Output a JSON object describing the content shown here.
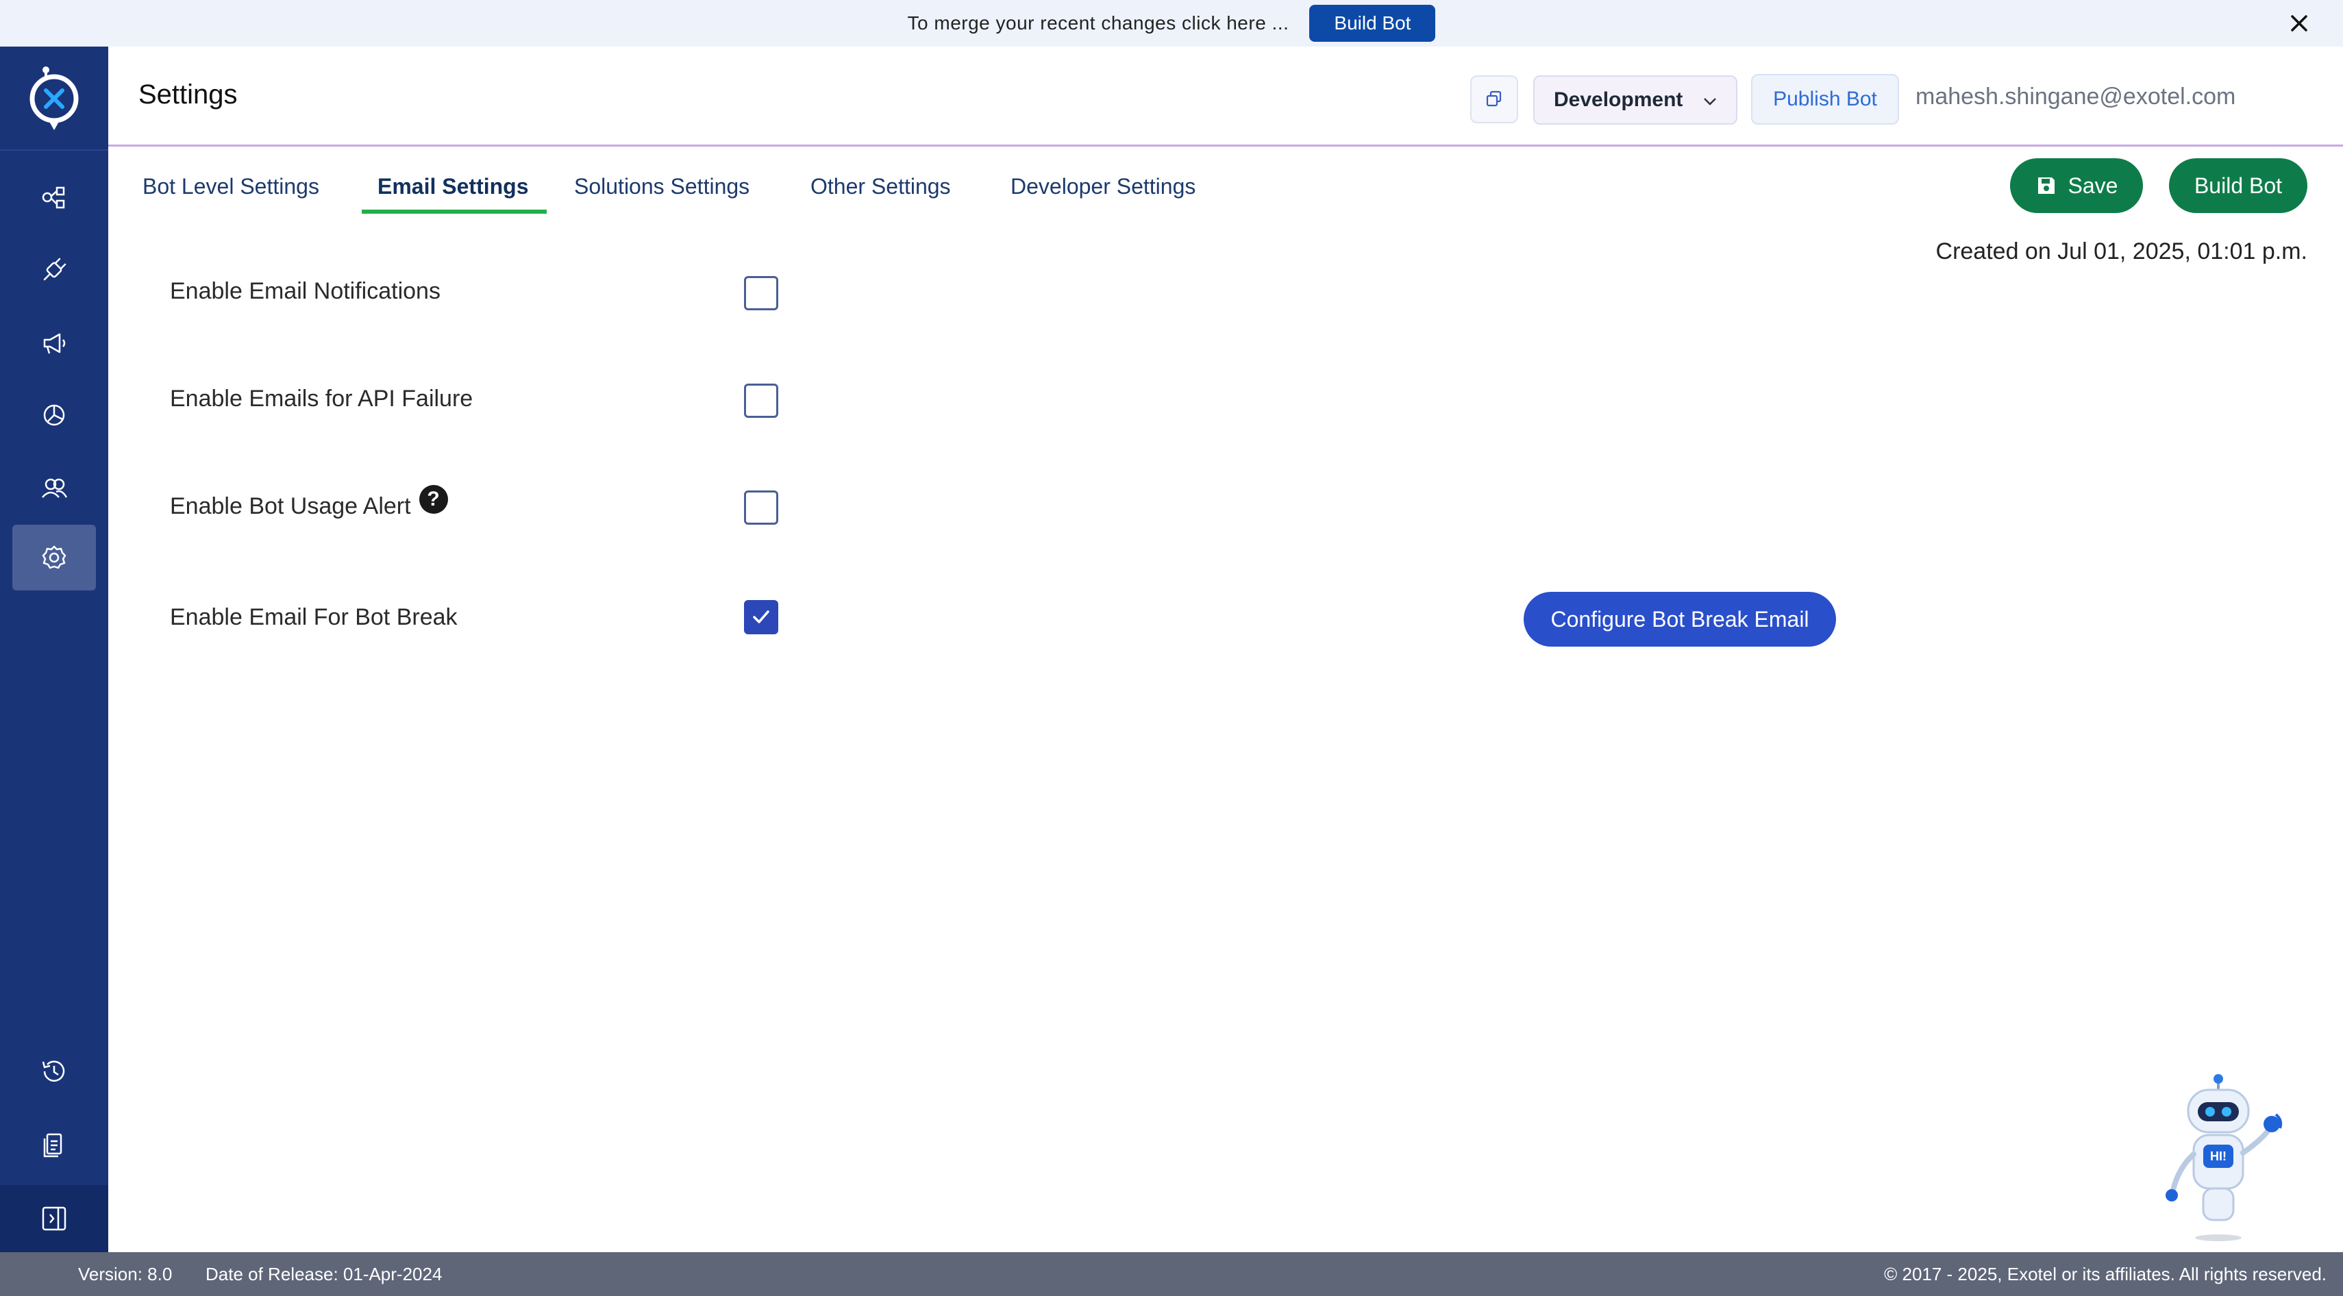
{
  "banner": {
    "message": "To merge your recent changes click here ...",
    "build_label": "Build Bot"
  },
  "sidebar": {
    "items": [
      {
        "icon": "flow-icon"
      },
      {
        "icon": "integrations-icon"
      },
      {
        "icon": "campaign-icon"
      },
      {
        "icon": "analytics-icon"
      },
      {
        "icon": "users-icon"
      },
      {
        "icon": "settings-icon",
        "active": true
      },
      {
        "icon": "history-icon"
      },
      {
        "icon": "documents-icon"
      },
      {
        "icon": "expand-sidebar-icon"
      }
    ]
  },
  "header": {
    "title": "Settings",
    "environment": "Development",
    "publish_label": "Publish Bot",
    "user_email": "mahesh.shingane@exotel.com"
  },
  "tabs": [
    {
      "label": "Bot Level Settings"
    },
    {
      "label": "Email Settings",
      "active": true
    },
    {
      "label": "Solutions Settings"
    },
    {
      "label": "Other Settings"
    },
    {
      "label": "Developer Settings"
    }
  ],
  "actions": {
    "save_label": "Save",
    "build_label": "Build Bot"
  },
  "created_on": "Created on Jul 01, 2025, 01:01 p.m.",
  "settings": [
    {
      "label": "Enable Email Notifications",
      "checked": false
    },
    {
      "label": "Enable Emails for API Failure",
      "checked": false
    },
    {
      "label": "Enable Bot Usage Alert",
      "checked": false,
      "help": "?"
    },
    {
      "label": "Enable Email For Bot Break",
      "checked": true
    }
  ],
  "configure_label": "Configure Bot Break Email",
  "robot_badge": "HI!",
  "footer": {
    "version": "Version: 8.0",
    "release": "Date of Release: 01-Apr-2024",
    "copyright": "© 2017 - 2025, Exotel or its affiliates. All rights reserved."
  },
  "colors": {
    "sidebar": "#1a3478",
    "primary_green": "#0e7c4a",
    "primary_blue": "#2a4fcb",
    "tab_underline": "#22b04b"
  }
}
